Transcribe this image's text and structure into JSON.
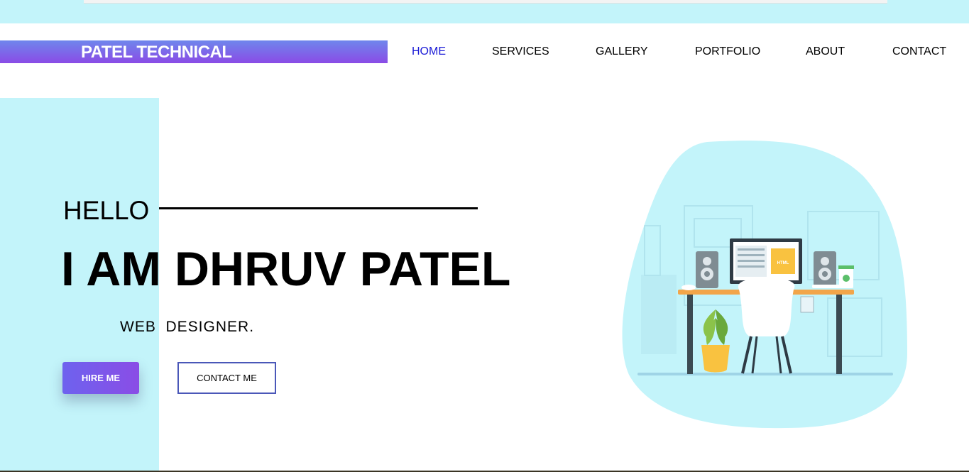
{
  "brand": {
    "name": "PATEL TECHNICAL"
  },
  "nav": {
    "items": [
      {
        "label": "HOME",
        "active": true
      },
      {
        "label": "SERVICES",
        "active": false
      },
      {
        "label": "GALLERY",
        "active": false
      },
      {
        "label": "PORTFOLIO",
        "active": false
      },
      {
        "label": "ABOUT",
        "active": false
      },
      {
        "label": "CONTACT",
        "active": false
      }
    ]
  },
  "hero": {
    "greeting": "HELLO",
    "headline": "I AM DHRUV PATEL",
    "role": "WEB  DESIGNER.",
    "hire_button": "HIRE ME",
    "contact_button": "CONTACT ME",
    "illustration": {
      "monitor_label": "HTML",
      "icons": [
        "speaker-icon",
        "monitor-icon",
        "plant-icon",
        "chair-icon",
        "cup-icon",
        "desk-icon"
      ]
    }
  },
  "colors": {
    "accent_cyan": "#c3f4fa",
    "gradient_start": "#6f86ec",
    "gradient_end": "#8a4be6",
    "nav_active": "#1a1ad6",
    "button_border": "#4a57b8"
  }
}
